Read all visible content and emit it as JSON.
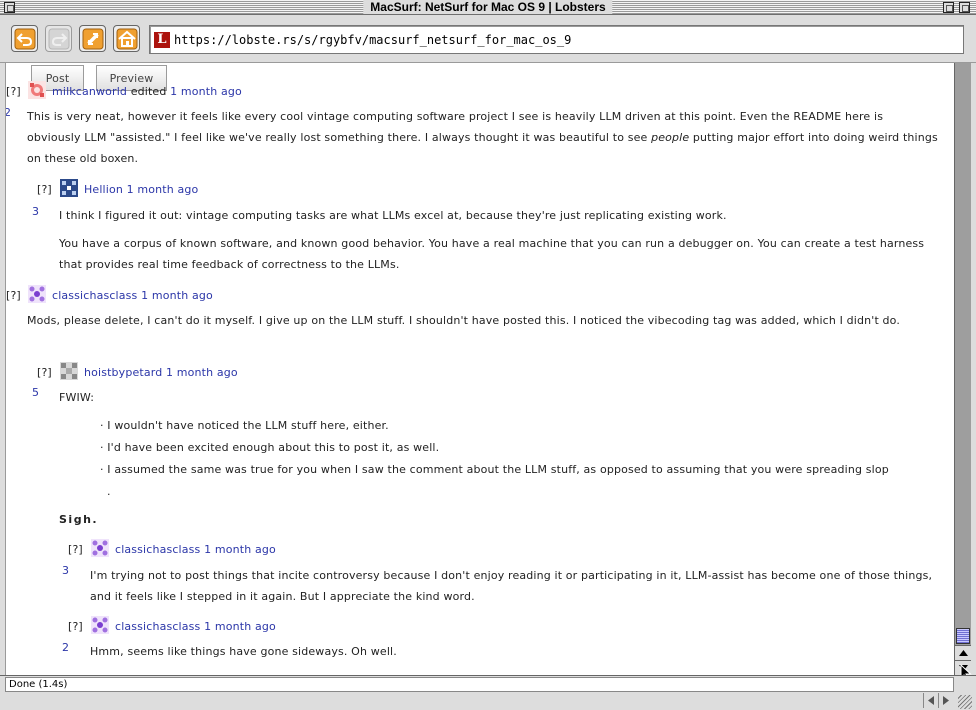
{
  "window": {
    "title": "MacSurf: NetSurf for Mac OS 9 | Lobsters"
  },
  "toolbar": {
    "icons": [
      "back-arrow-icon",
      "forward-arrow-icon",
      "reload-icon",
      "home-icon"
    ],
    "favicon_letter": "L",
    "url": "https://lobste.rs/s/rgybfv/macsurf_netsurf_for_mac_os_9"
  },
  "form": {
    "post_label": "Post",
    "preview_label": "Preview"
  },
  "comments": [
    {
      "bracket": "[?]",
      "user": "milkcanworld",
      "action": "edited",
      "time": "1 month ago",
      "score": "2",
      "body": [
        "This is very neat, however it feels like every cool vintage computing software project I see is heavily LLM driven at this point. Even the README here is obviously LLM \"assisted.\" I feel like we've really lost something there. I always thought it was beautiful to see ",
        "people",
        " putting major effort into doing weird things on these old boxen."
      ]
    },
    {
      "bracket": "[?]",
      "user": "Hellion",
      "time": "1 month ago",
      "score": "3",
      "body": [
        "I think I figured it out: vintage computing tasks are what LLMs excel at, because they're just replicating existing work.",
        "You have a corpus of known software, and known good behavior. You have a real machine that you can run a debugger on. You can create a test harness that provides real time feedback of correctness to the LLMs."
      ]
    },
    {
      "bracket": "[?]",
      "user": "classichasclass",
      "time": "1 month ago",
      "body": [
        "Mods, please delete, I can't do it myself. I give up on the LLM stuff. I shouldn't have posted this. I noticed the vibecoding tag was added, which I didn't do."
      ]
    },
    {
      "bracket": "[?]",
      "user": "hoistbypetard",
      "time": "1 month ago",
      "score": "5",
      "intro": "FWIW:",
      "bullets": [
        "· I wouldn't have noticed the LLM stuff here, either.",
        "· I'd have been excited enough about this to post it, as well.",
        "· I assumed the same was true for you when I saw the comment about the LLM stuff, as opposed to assuming that you were spreading slop",
        "."
      ],
      "strong": "Sigh."
    },
    {
      "bracket": "[?]",
      "user": "classichasclass",
      "time": "1 month ago",
      "score": "3",
      "body": [
        "I'm trying not to post things that incite controversy because I don't enjoy reading it or participating in it, LLM-assist has become one of those things, and it feels like I stepped in it again. But I appreciate the kind word."
      ]
    },
    {
      "bracket": "[?]",
      "user": "classichasclass",
      "time": "1 month ago",
      "score": "2",
      "body": [
        "Hmm, seems like things have gone sideways. Oh well."
      ]
    }
  ],
  "status": {
    "text": "Done (1.4s)"
  },
  "colors": {
    "link": "#2b36a8",
    "lobsters_red": "#ac130d",
    "toolbar_icon": "#f0a030",
    "scroll_thumb": "#6f6fd2"
  }
}
